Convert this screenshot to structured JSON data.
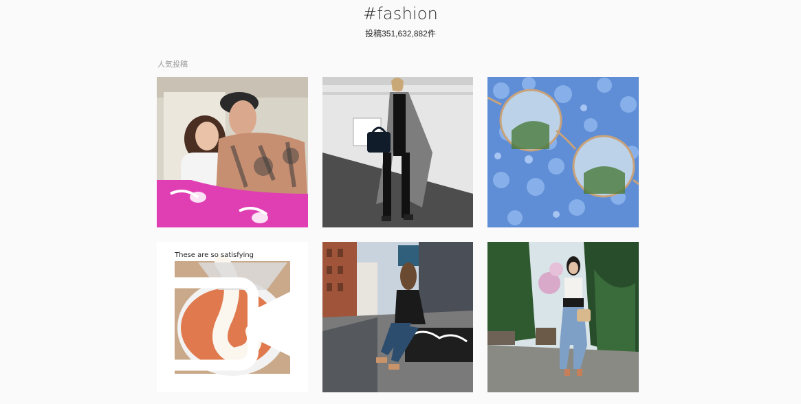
{
  "header": {
    "hashtag": "#fashion",
    "post_count": "投稿351,632,882件"
  },
  "top_posts": {
    "label": "人気投稿",
    "tiles": [
      {
        "caption_overlay": ""
      },
      {
        "caption_overlay": ""
      },
      {
        "caption_overlay": ""
      },
      {
        "caption_overlay": "These are so satisfying",
        "is_video": true
      },
      {
        "caption_overlay": ""
      },
      {
        "caption_overlay": ""
      }
    ]
  },
  "colors": {
    "background": "#fafafa",
    "text": "#262626",
    "muted": "#999999"
  }
}
